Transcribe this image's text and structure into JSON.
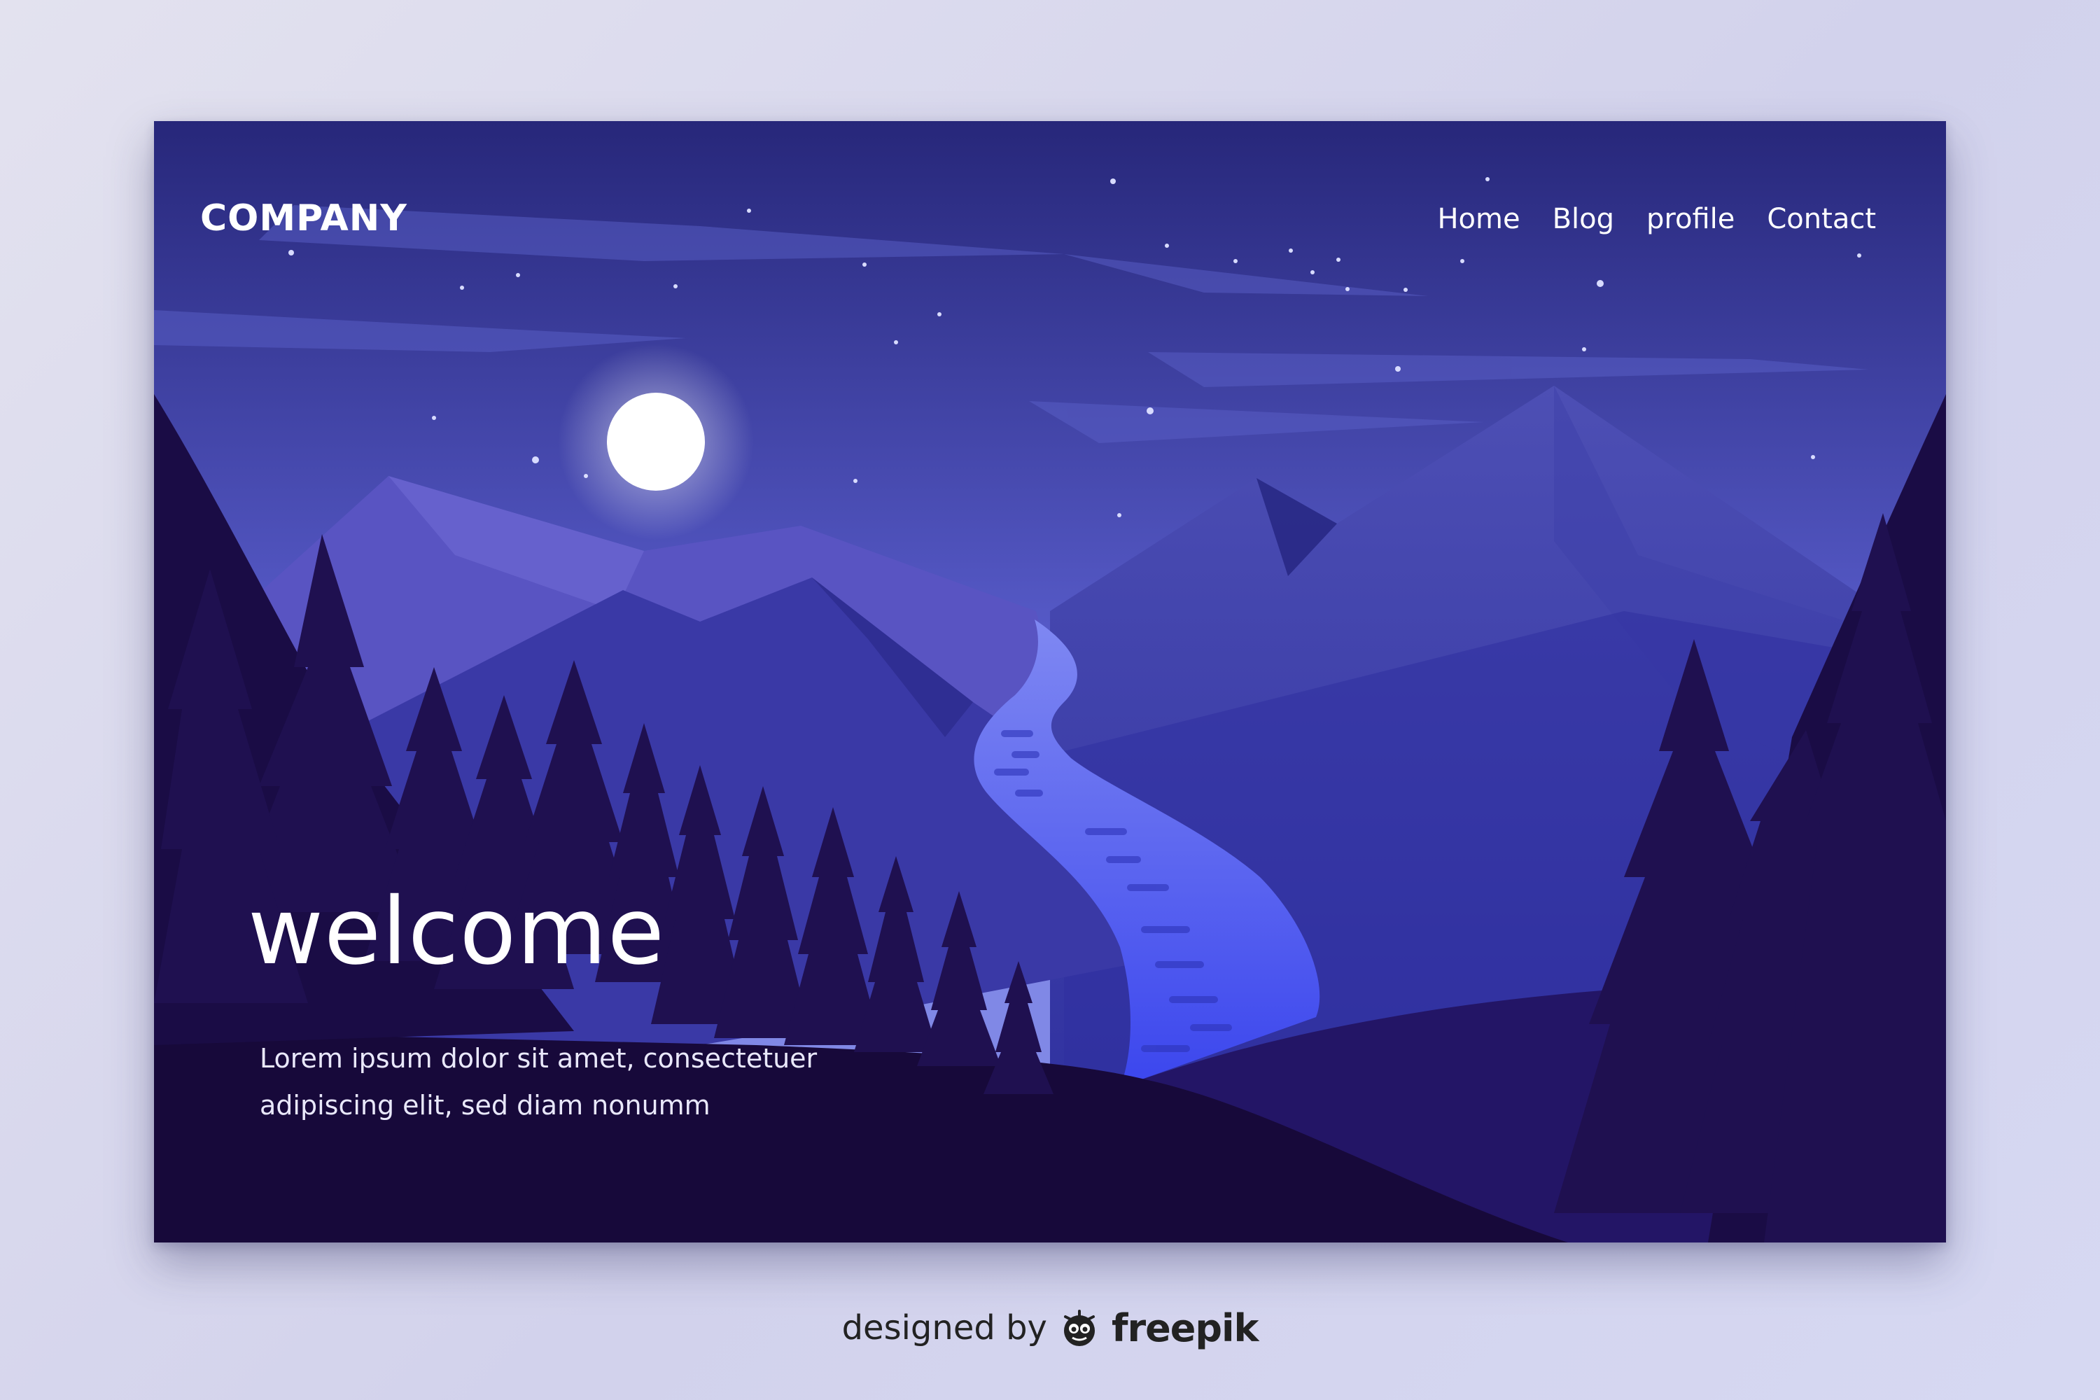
{
  "header": {
    "logo": "COMPANY",
    "nav": [
      {
        "label": "Home"
      },
      {
        "label": "Blog"
      },
      {
        "label": "profile"
      },
      {
        "label": "Contact"
      }
    ]
  },
  "hero": {
    "title": "welcome",
    "lines": [
      "Lorem ipsum dolor sit amet, consectetuer",
      "adipiscing elit, sed diam nonumm"
    ]
  },
  "footer": {
    "credit_text": "designed by",
    "brand": "freepik",
    "brand_icon": "freepik-logo-icon"
  },
  "colors": {
    "sky_top": "#27277a",
    "sky_horizon": "#8088e6",
    "moon": "#ffffff",
    "river": "#4a5cf0",
    "foreground": "#17093a",
    "trees": "#1f1050"
  }
}
